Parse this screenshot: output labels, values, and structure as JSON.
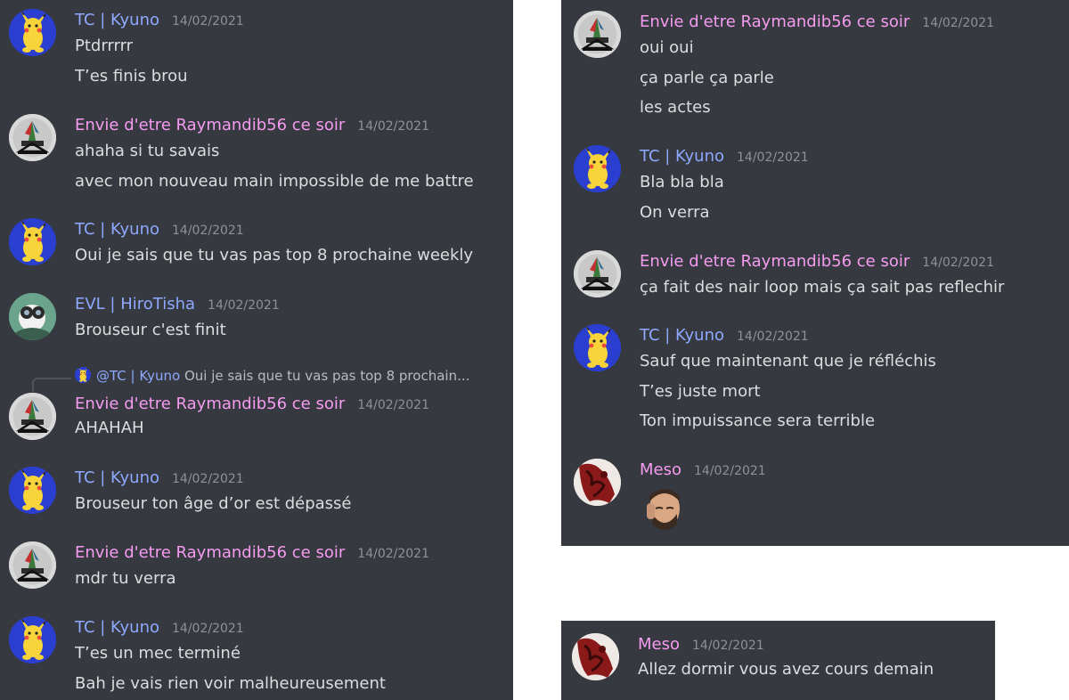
{
  "left": {
    "messages": [
      {
        "author": "TC | Kyuno",
        "time": "14/02/2021",
        "lines": [
          "Ptdrrrrr",
          "T’es finis brou"
        ]
      },
      {
        "author": "Envie d'etre Raymandib56 ce soir",
        "time": "14/02/2021",
        "lines": [
          "ahaha si tu savais",
          "avec mon nouveau main impossible de me battre"
        ]
      },
      {
        "author": "TC | Kyuno",
        "time": "14/02/2021",
        "lines": [
          "Oui je sais que tu vas pas top 8 prochaine weekly"
        ]
      },
      {
        "author": "EVL | HiroTisha",
        "time": "14/02/2021",
        "lines": [
          "Brouseur c'est finit"
        ]
      },
      {
        "author": "Envie d'etre Raymandib56 ce soir",
        "time": "14/02/2021",
        "lines": [
          "AHAHAH"
        ],
        "reply": {
          "mention": "@TC | Kyuno",
          "preview": "Oui je sais que tu vas pas top 8 prochain..."
        }
      },
      {
        "author": "TC | Kyuno",
        "time": "14/02/2021",
        "lines": [
          "Brouseur ton âge d’or est dépassé"
        ]
      },
      {
        "author": "Envie d'etre Raymandib56 ce soir",
        "time": "14/02/2021",
        "lines": [
          "mdr tu verra"
        ]
      },
      {
        "author": "TC | Kyuno",
        "time": "14/02/2021",
        "lines": [
          "T’es un mec terminé",
          "Bah je vais rien voir malheureusement"
        ]
      }
    ]
  },
  "right": {
    "messages": [
      {
        "author": "Envie d'etre Raymandib56 ce soir",
        "time": "14/02/2021",
        "lines": [
          "oui oui",
          "ça parle ça parle",
          "les actes"
        ]
      },
      {
        "author": "TC | Kyuno",
        "time": "14/02/2021",
        "lines": [
          "Bla bla bla",
          "On verra"
        ]
      },
      {
        "author": "Envie d'etre Raymandib56 ce soir",
        "time": "14/02/2021",
        "lines": [
          "ça fait des nair loop mais ça sait pas reflechir"
        ]
      },
      {
        "author": "TC | Kyuno",
        "time": "14/02/2021",
        "lines": [
          "Sauf que maintenant que je réfléchis",
          "T’es juste mort",
          "Ton impuissance sera terrible"
        ]
      },
      {
        "author": "Meso",
        "time": "14/02/2021",
        "lines": []
      }
    ]
  },
  "bottom": {
    "messages": [
      {
        "author": "Meso",
        "time": "14/02/2021",
        "lines": [
          "Allez dormir vous avez cours demain"
        ]
      }
    ]
  },
  "colors": {
    "background": "#36393f",
    "name_blue": "#8ea9ff",
    "name_pink": "#f59bf0",
    "text": "#dcddde",
    "timestamp": "#8e9297"
  },
  "icons": {
    "kyuno": "pikachu-avatar-icon",
    "envie": "raymandib-avatar-icon",
    "hiro": "hirotisha-avatar-icon",
    "meso": "meso-avatar-icon",
    "emoji": "custom-emoji-face"
  }
}
